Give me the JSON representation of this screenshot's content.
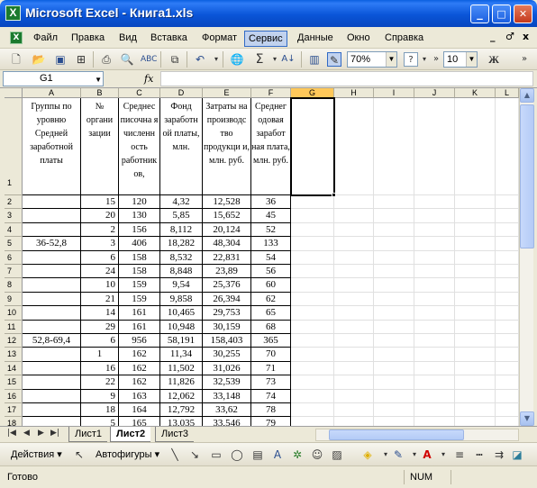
{
  "window": {
    "title": "Microsoft Excel - Книга1.xls",
    "app_icon": "X",
    "minimize": "_",
    "maximize": "□",
    "close": "✕"
  },
  "menu": {
    "items": [
      "Файл",
      "Правка",
      "Вид",
      "Вставка",
      "Формат",
      "Сервис",
      "Данные",
      "Окно",
      "Справка"
    ],
    "active": "Сервис",
    "window_controls": [
      "_",
      "♂",
      "x"
    ]
  },
  "toolbar": {
    "zoom": "70%",
    "font_size": "10",
    "bold_label": "Ж",
    "more": "»"
  },
  "formula_bar": {
    "name_box": "G1",
    "fx_label": "fx",
    "formula": ""
  },
  "grid": {
    "columns": [
      "A",
      "B",
      "C",
      "D",
      "E",
      "F",
      "G",
      "H",
      "I",
      "J",
      "K",
      "L"
    ],
    "selected_column": "G",
    "rows": [
      "1",
      "2",
      "3",
      "4",
      "5",
      "6",
      "7",
      "8",
      "9",
      "10",
      "11",
      "12",
      "13",
      "14",
      "15",
      "16",
      "17",
      "18"
    ],
    "headers": [
      "Группы по уровню Средней заработной платы",
      "№ органи зации",
      "Среднес писочна я численн ость работник ов,",
      "Фонд заработн ой платы, млн.",
      "Затраты на производс тво продукци и, млн. руб.",
      "Среднег одовая заработ ная плата, млн. руб."
    ],
    "data": [
      [
        "",
        "15",
        "120",
        "4,32",
        "12,528",
        "36"
      ],
      [
        "",
        "20",
        "130",
        "5,85",
        "15,652",
        "45"
      ],
      [
        "",
        "2",
        "156",
        "8,112",
        "20,124",
        "52"
      ],
      [
        "36-52,8",
        "3",
        "406",
        "18,282",
        "48,304",
        "133"
      ],
      [
        "",
        "6",
        "158",
        "8,532",
        "22,831",
        "54"
      ],
      [
        "",
        "24",
        "158",
        "8,848",
        "23,89",
        "56"
      ],
      [
        "",
        "10",
        "159",
        "9,54",
        "25,376",
        "60"
      ],
      [
        "",
        "21",
        "159",
        "9,858",
        "26,394",
        "62"
      ],
      [
        "",
        "14",
        "161",
        "10,465",
        "29,753",
        "65"
      ],
      [
        "",
        "29",
        "161",
        "10,948",
        "30,159",
        "68"
      ],
      [
        "52,8-69,4",
        "6",
        "956",
        "58,191",
        "158,403",
        "365"
      ],
      [
        "",
        "1",
        "162",
        "11,34",
        "30,255",
        "70"
      ],
      [
        "",
        "16",
        "162",
        "11,502",
        "31,026",
        "71"
      ],
      [
        "",
        "22",
        "162",
        "11,826",
        "32,539",
        "73"
      ],
      [
        "",
        "9",
        "163",
        "12,062",
        "33,148",
        "74"
      ],
      [
        "",
        "18",
        "164",
        "12,792",
        "33,62",
        "78"
      ],
      [
        "",
        "5",
        "165",
        "13,035",
        "33,546",
        "79"
      ]
    ]
  },
  "sheets": {
    "tabs": [
      "Лист1",
      "Лист2",
      "Лист3"
    ],
    "active": "Лист2"
  },
  "drawing": {
    "actions_label": "Действия",
    "autoshapes_label": "Автофигуры"
  },
  "status": {
    "ready": "Готово",
    "num": "NUM"
  },
  "colors": {
    "title_bar": "#0a55d8",
    "selected_header": "#ffc85a",
    "chrome": "#ece9d8"
  }
}
